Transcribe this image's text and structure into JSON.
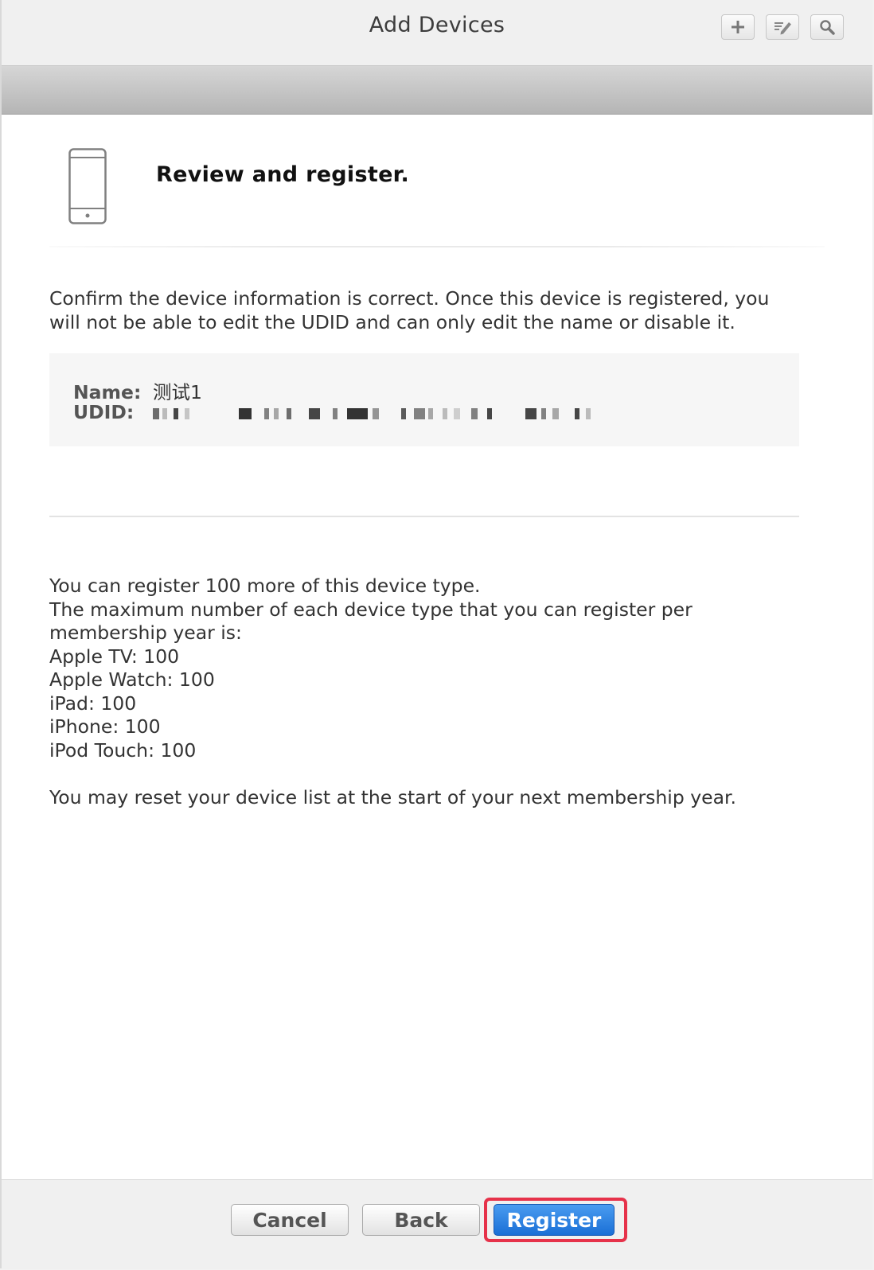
{
  "window": {
    "title": "Add Devices",
    "toolbar": [
      "plus-icon",
      "edit-icon",
      "search-icon"
    ]
  },
  "header": {
    "icon": "iphone-icon",
    "heading": "Review and register."
  },
  "intro_text": "Confirm the device information is correct. Once this device is registered, you will not be able to edit the UDID and can only edit the name or disable it.",
  "device": {
    "name_label": "Name:",
    "name_value": "测试1",
    "udid_label": "UDID:"
  },
  "limits": {
    "remaining": "You can register 100 more of this device type.",
    "max_intro": "The maximum number of each device type that you can register per membership year is:",
    "items": [
      "Apple TV: 100",
      "Apple Watch: 100",
      "iPad: 100",
      "iPhone: 100",
      "iPod Touch: 100"
    ],
    "reset_note": "You may reset your device list at the start of your next membership year."
  },
  "footer": {
    "cancel_label": "Cancel",
    "back_label": "Back",
    "register_label": "Register"
  },
  "colors": {
    "primary_button": "#1a6fd6",
    "highlight_border": "#e6324a"
  }
}
